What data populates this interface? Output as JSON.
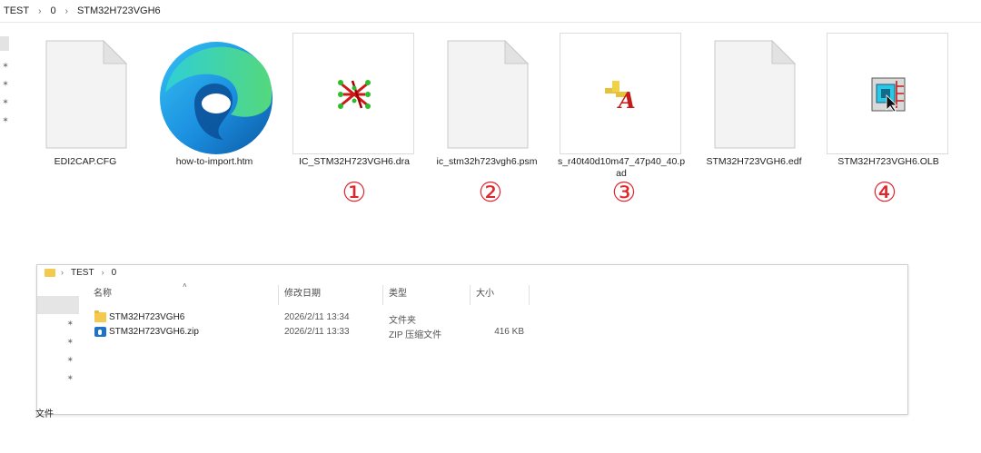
{
  "top_window": {
    "breadcrumb": [
      "TEST",
      "0",
      "STM32H723VGH6"
    ],
    "files": [
      {
        "name": "EDI2CAP.CFG",
        "icon": "blank-document-icon",
        "marker": ""
      },
      {
        "name": "how-to-import.htm",
        "icon": "edge-browser-icon",
        "marker": ""
      },
      {
        "name": "IC_STM32H723VGH6.dra",
        "icon": "allegro-drawing-icon",
        "marker": "①"
      },
      {
        "name": "ic_stm32h723vgh6.psm",
        "icon": "blank-document-icon",
        "marker": "②"
      },
      {
        "name": "s_r40t40d10m47_47p40_40.pad",
        "icon": "padstack-editor-icon",
        "marker": "③"
      },
      {
        "name": "STM32H723VGH6.edf",
        "icon": "blank-document-icon",
        "marker": ""
      },
      {
        "name": "STM32H723VGH6.OLB",
        "icon": "capture-library-icon",
        "marker": "④"
      }
    ]
  },
  "bottom_window": {
    "breadcrumb": [
      "TEST",
      "0"
    ],
    "columns": {
      "name": "名称",
      "date": "修改日期",
      "type": "类型",
      "size": "大小"
    },
    "rows": [
      {
        "name": "STM32H723VGH6",
        "date": "2026/2/11 13:34",
        "type": "文件夹",
        "size": "",
        "icon": "folder-icon"
      },
      {
        "name": "STM32H723VGH6.zip",
        "date": "2026/2/11 13:33",
        "type": "ZIP 压缩文件",
        "size": "416 KB",
        "icon": "zip-archive-icon"
      }
    ],
    "status": "文件"
  },
  "colors": {
    "marker": "#e0262d",
    "folder": "#f4c94f",
    "accent": "#1e73c8"
  }
}
